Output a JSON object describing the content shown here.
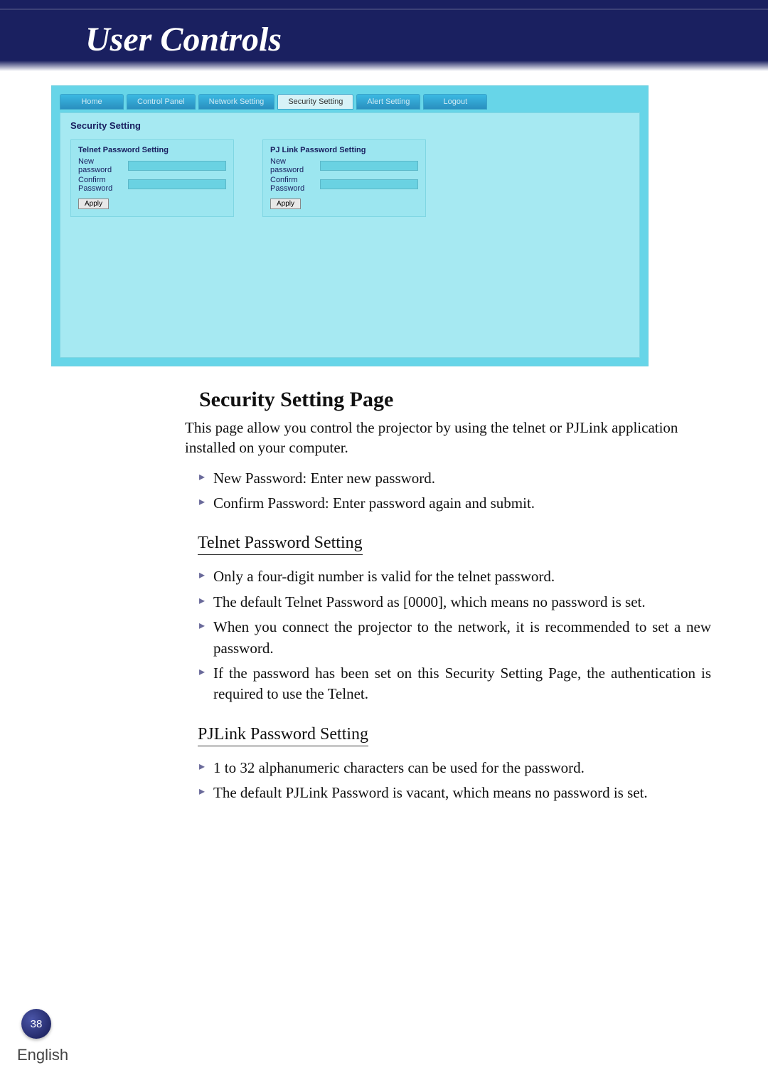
{
  "header": {
    "title": "User Controls"
  },
  "screenshot": {
    "tabs": {
      "home": "Home",
      "control_panel": "Control Panel",
      "network_setting": "Network Setting",
      "security_setting": "Security Setting",
      "alert_setting": "Alert Setting",
      "logout": "Logout"
    },
    "panel_title": "Security Setting",
    "telnet_block": {
      "title": "Telnet Password Setting",
      "new_password_label": "New password",
      "confirm_password_label": "Confirm Password",
      "apply": "Apply"
    },
    "pjlink_block": {
      "title": "PJ Link Password Setting",
      "new_password_label": "New password",
      "confirm_password_label": "Confirm Password",
      "apply": "Apply"
    }
  },
  "content": {
    "section_title": "Security Setting Page",
    "intro": "This page allow you control the projector by using the telnet or PJLink application installed on your computer.",
    "top_bullets": [
      "New Password: Enter new password.",
      "Confirm Password: Enter password again and submit."
    ],
    "telnet_heading": "Telnet Password Setting",
    "telnet_bullets": [
      "Only a four-digit number is valid for the telnet password.",
      "The default Telnet Password as [0000], which means no password is set.",
      "When you connect the projector to the network, it is recommended to set a new password.",
      "If the password has been set on this Security Setting Page, the authentication is required to use the Telnet."
    ],
    "pjlink_heading": "PJLink Password Setting",
    "pjlink_bullets": [
      "1 to 32 alphanumeric characters can be used for the password.",
      "The default PJLink Password is vacant, which means no password is set."
    ]
  },
  "footer": {
    "page_number": "38",
    "language": "English"
  }
}
